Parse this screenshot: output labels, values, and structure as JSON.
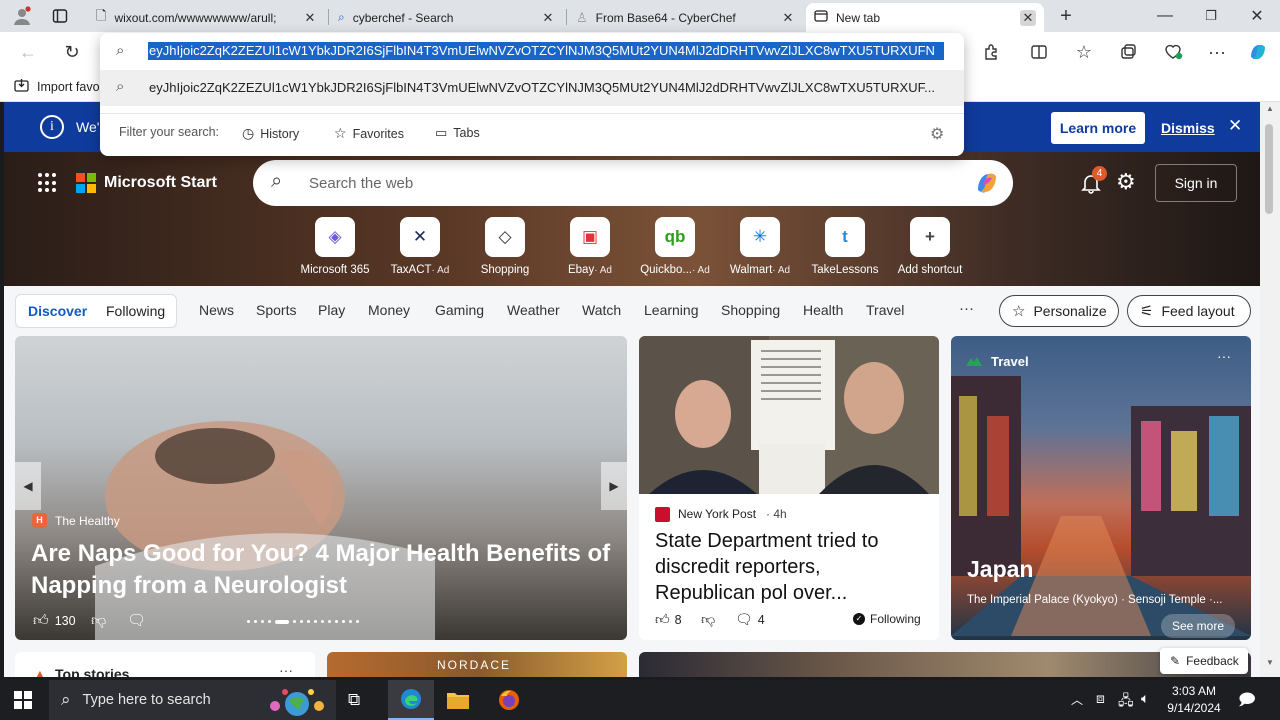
{
  "tabs": [
    {
      "label": "wixout.com/wwwwwwww/arull;",
      "icon": "page-icon"
    },
    {
      "label": "cyberchef - Search",
      "icon": "search-icon"
    },
    {
      "label": "From Base64 - CyberChef",
      "icon": "cyberchef-icon"
    },
    {
      "label": "New tab",
      "icon": "newtab-icon"
    }
  ],
  "address": {
    "value": "eyJhIjoic2ZqK2ZEZUl1cW1YbkJDR2I6SjFlbIN4T3VmUElwNVZvOTZCYlNJM3Q5MUt2YUN4MlJ2dDRHTVwvZlJLXC8wTXU5TURXUFN",
    "suggestion": "eyJhIjoic2ZqK2ZEZUl1cW1YbkJDR2I6SjFlbIN4T3VmUElwNVZvOTZCYlNJM3Q5MUt2YUN4MlJ2dDRHTVwvZlJLXC8wTXU5TURXUF...",
    "filter_label": "Filter your search:",
    "filters": [
      "History",
      "Favorites",
      "Tabs"
    ]
  },
  "favbar": {
    "import": "Import favo"
  },
  "banner": {
    "text": "We'",
    "learn_more": "Learn more",
    "dismiss": "Dismiss"
  },
  "msn": {
    "brand": "Microsoft Start",
    "search_placeholder": "Search the web",
    "notif_count": "4",
    "signin": "Sign in",
    "tiles": [
      {
        "label": "Microsoft 365",
        "ad": "",
        "glyph": "◈",
        "color": "#6b5bd6"
      },
      {
        "label": "TaxACT",
        "ad": "· Ad",
        "glyph": "✕",
        "color": "#1b2a5e"
      },
      {
        "label": "Shopping",
        "ad": "",
        "glyph": "◇",
        "color": "#333333"
      },
      {
        "label": "Ebay",
        "ad": "· Ad",
        "glyph": "▣",
        "color": "#e53238"
      },
      {
        "label": "Quickbo...",
        "ad": "· Ad",
        "glyph": "qb",
        "color": "#2ca01c"
      },
      {
        "label": "Walmart",
        "ad": "· Ad",
        "glyph": "✳",
        "color": "#0071dc"
      },
      {
        "label": "TakeLessons",
        "ad": "",
        "glyph": "t",
        "color": "#2b8ad6"
      },
      {
        "label": "Add shortcut",
        "ad": "",
        "glyph": "+",
        "color": "#444444"
      }
    ]
  },
  "nav": {
    "discover": "Discover",
    "following": "Following",
    "items": [
      "News",
      "Sports",
      "Play",
      "Money",
      "Gaming",
      "Weather",
      "Watch",
      "Learning",
      "Shopping",
      "Health",
      "Travel"
    ],
    "more": "···",
    "personalize": "Personalize",
    "feed_layout": "Feed layout"
  },
  "cards": {
    "main": {
      "source": "The Healthy",
      "headline": "Are Naps Good for You? 4 Major Health Benefits of Napping from a Neurologist",
      "likes": "130"
    },
    "news": {
      "source": "New York Post",
      "age": "· 4h",
      "headline": "State Department tried to discredit reporters, Republican pol over...",
      "likes": "8",
      "comments": "4",
      "following": "Following"
    },
    "travel": {
      "tag": "Travel",
      "title": "Japan",
      "subtitle": "The Imperial Palace (Kyokyo) · Sensoji Temple ·...",
      "see_more": "See more"
    },
    "bottom": {
      "top_stories": "Top stories",
      "nordace": "NORDACE",
      "feedback": "Feedback"
    }
  },
  "taskbar": {
    "search_placeholder": "Type here to search",
    "time": "3:03 AM",
    "date": "9/14/2024"
  }
}
